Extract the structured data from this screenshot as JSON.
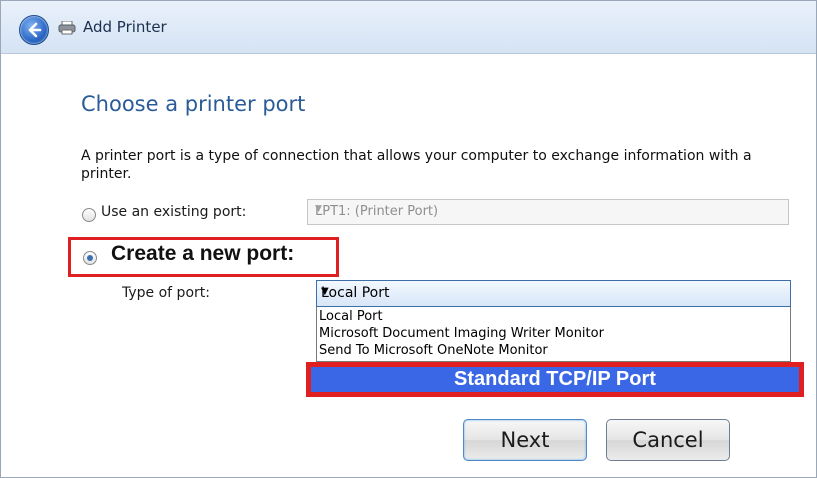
{
  "window": {
    "title": "Add Printer"
  },
  "page": {
    "heading": "Choose a printer port",
    "description": "A printer port is a type of connection that allows your computer to exchange information with a printer."
  },
  "options": {
    "existing_label": "Use an existing port:",
    "existing_value": "LPT1: (Printer Port)",
    "new_label": "Create a new port:",
    "type_label": "Type of port:",
    "type_value": "Local Port",
    "dropdown_items": [
      "Local Port",
      "Microsoft Document Imaging Writer Monitor",
      "Send To Microsoft OneNote Monitor"
    ],
    "highlighted_item": "Standard TCP/IP Port"
  },
  "buttons": {
    "next": "Next",
    "cancel": "Cancel"
  },
  "icons": {
    "back": "back-arrow-icon",
    "printer": "printer-icon"
  },
  "colors": {
    "heading": "#2a5b98",
    "highlight_border": "#e02020",
    "selection": "#3a67e6"
  }
}
